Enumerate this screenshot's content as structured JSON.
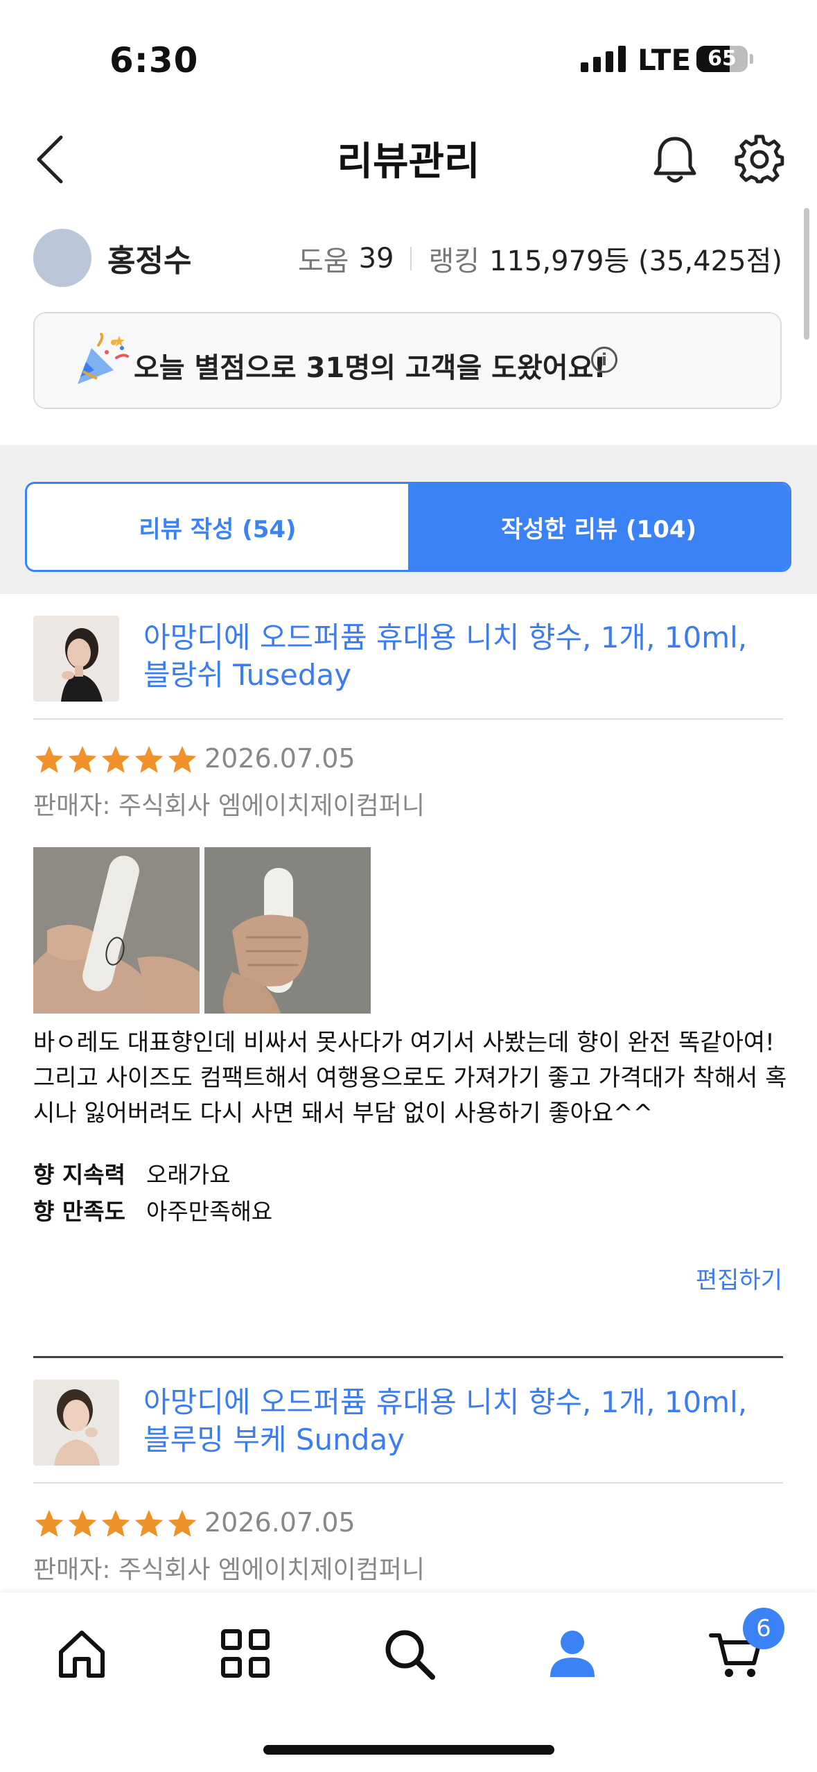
{
  "status_bar": {
    "time": "6:30",
    "network": "LTE",
    "battery": "65",
    "battery_level": 0.65
  },
  "header": {
    "title": "리뷰관리"
  },
  "profile": {
    "name": "홍정수",
    "help_label": "도움",
    "help_count": "39",
    "ranking_label": "랭킹",
    "ranking_value": "115,979등 (35,425점)"
  },
  "banner": {
    "text": "오늘 별점으로 31명의 고객을 도왔어요!",
    "info_symbol": "i"
  },
  "tabs": [
    {
      "label": "리뷰 작성 (54)",
      "active": false
    },
    {
      "label": "작성한 리뷰 (104)",
      "active": true
    }
  ],
  "reviews": [
    {
      "product_title": "아망디에 오드퍼퓸 휴대용 니치 향수, 1개, 10ml, 블랑쉬 Tuseday",
      "rating": 5,
      "date": "2026.07.05",
      "seller": "판매자: 주식회사 엠에이치제이컴퍼니",
      "body": "바ㅇ레도 대표향인데 비싸서 못사다가 여기서 사봤는데 향이 완전 똑같아여! 그리고 사이즈도 컴팩트해서 여행용으로도 가져가기 좋고 가격대가 착해서 혹시나 잃어버려도 다시 사면 돼서 부담 없이 사용하기 좋아요^^",
      "attributes": [
        {
          "key": "향 지속력",
          "value": "오래가요"
        },
        {
          "key": "향 만족도",
          "value": "아주만족해요"
        }
      ],
      "edit_label": "편집하기"
    },
    {
      "product_title": "아망디에 오드퍼퓸 휴대용 니치 향수, 1개, 10ml, 블루밍 부케 Sunday",
      "rating": 5,
      "date": "2026.07.05",
      "seller": "판매자: 주식회사 엠에이치제이컴퍼니"
    }
  ],
  "bottom_nav": {
    "items": [
      "home-icon",
      "categories-icon",
      "search-icon",
      "profile-icon",
      "cart-icon"
    ],
    "cart_badge": "6"
  },
  "colors": {
    "accent": "#3b82f6",
    "link": "#3b7cf0",
    "star": "#f0922b"
  }
}
